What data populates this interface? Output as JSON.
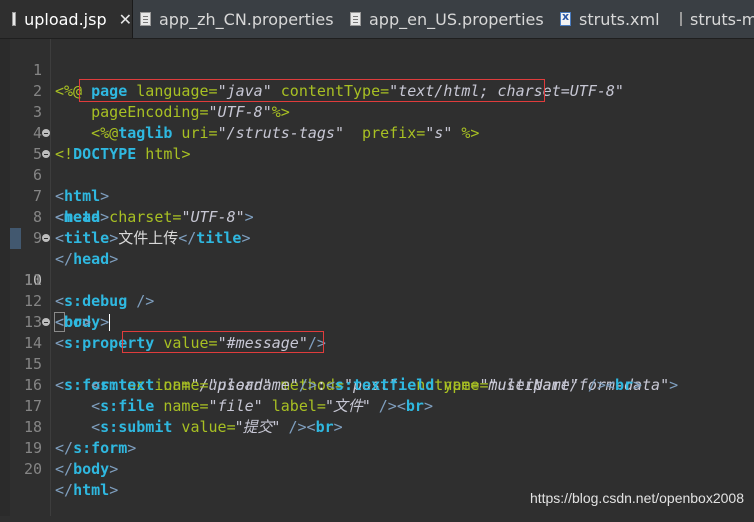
{
  "tabs": [
    {
      "label": "upload.jsp",
      "icon": "page-icon",
      "active": true,
      "close": "✕"
    },
    {
      "label": "app_zh_CN.properties",
      "icon": "page-icon"
    },
    {
      "label": "app_en_US.properties",
      "icon": "page-icon"
    },
    {
      "label": "struts.xml",
      "icon": "xml-icon"
    },
    {
      "label": "struts-m",
      "icon": "page-icon"
    }
  ],
  "lines": {
    "l1": {
      "n": "1",
      "s1": "<%@ ",
      "k": "page",
      "a1": " language=",
      "v1": "\"java\"",
      "a2": " contentType=",
      "v2": "\"text/html; charset=UTF-8\""
    },
    "l2": {
      "n": "2",
      "a1": "    pageEncoding=",
      "v1": "\"UTF-8\"",
      "s2": "%>"
    },
    "l3": {
      "n": "3",
      "s1": "    <%@",
      "k": "taglib",
      "a1": " uri=",
      "v1": "\"/struts-tags\"",
      "a2": "  prefix=",
      "v2": "\"s\"",
      "s2": " %>"
    },
    "l4": {
      "n": "4",
      "s1": "<!",
      "k": "DOCTYPE",
      "p": " html",
      "s2": ">"
    },
    "l5": {
      "n": "5",
      "s1": "<",
      "k": "html",
      "s2": ">"
    },
    "l6": {
      "n": "6",
      "s1": "<",
      "k": "head",
      "s2": ">"
    },
    "l7": {
      "n": "7",
      "s1": "<",
      "k": "meta",
      "a1": " charset=",
      "v1": "\"UTF-8\"",
      "s2": ">"
    },
    "l8": {
      "n": "8",
      "s1": "<",
      "k": "title",
      "s2": ">",
      "txt": "文件上传",
      "s3": "</",
      "k2": "title",
      "s4": ">"
    },
    "l9": {
      "n": "9",
      "s1": "</",
      "k": "head",
      "s2": ">"
    },
    "l10": {
      "n": "10",
      "s1": "<",
      "k": "body",
      "s2": ">"
    },
    "l11": {
      "n": "11",
      "s1": "<",
      "k": "s:debug",
      "s2": " />"
    },
    "l12": {
      "n": "12",
      "s1": "<",
      "k": "br",
      "s2": ">"
    },
    "l13": {
      "n": "13",
      "s1": "<",
      "k": "s:property",
      "a1": " value=",
      "v1": "\"#message\"",
      "s2": "/>"
    },
    "l14": {
      "n": "14",
      "s1": "<",
      "k": "s:form",
      "a1": " action=",
      "v1": "\"/upload\"",
      "a2": " method=",
      "v2": "\"post\"",
      "a3": " enctype=",
      "v3": "\"multipart/form-data\"",
      "s2": ">"
    },
    "l15": {
      "n": "15",
      "s1": "    <",
      "k": "s:",
      "k2": "text",
      "a1": " name=",
      "v1": "\"username\"",
      "s2": "/>",
      "p": ":",
      "s3": "<",
      "k3": "s:textfield",
      "a2": " name=",
      "v2": "\"userName\"",
      "s4": " /><",
      "k4": "br",
      "s5": ">"
    },
    "l16": {
      "n": "16",
      "s1": "    <",
      "k": "s:file",
      "a1": " name=",
      "v1": "\"file\"",
      "a2": " label=",
      "v2": "\"文件\"",
      "s2": " /><",
      "k2": "br",
      "s3": ">"
    },
    "l17": {
      "n": "17",
      "s1": "    <",
      "k": "s:submit",
      "a1": " value=",
      "v1": "\"提交\"",
      "s2": " /><",
      "k2": "br",
      "s3": ">"
    },
    "l18": {
      "n": "18",
      "s1": "</",
      "k": "s:form",
      "s2": ">"
    },
    "l19": {
      "n": "19",
      "s1": "</",
      "k": "body",
      "s2": ">"
    },
    "l20": {
      "n": "20",
      "s1": "</",
      "k": "html",
      "s2": ">"
    }
  },
  "watermark": "https://blog.csdn.net/openbox2008",
  "colors": {
    "highlight_box": "#e03c3c",
    "tag": "#2fb8e0",
    "attribute": "#a8c023",
    "value": "#c7c7d4"
  }
}
